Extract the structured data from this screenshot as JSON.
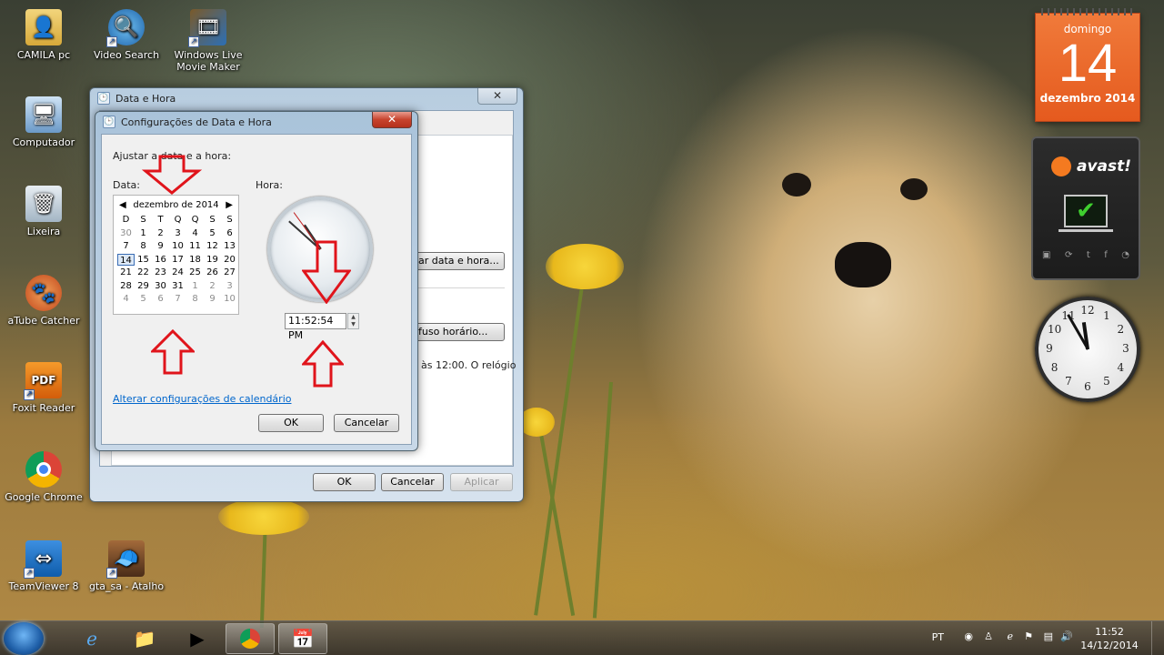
{
  "desktop": {
    "icons": [
      {
        "label": "CAMILA pc"
      },
      {
        "label": "Video Search"
      },
      {
        "label": "Windows Live Movie Maker"
      },
      {
        "label": "Computador"
      },
      {
        "label": "Lixeira"
      },
      {
        "label": "aTube Catcher"
      },
      {
        "label": "Foxit Reader"
      },
      {
        "label": "Google Chrome"
      },
      {
        "label": "TeamViewer 8"
      },
      {
        "label": "gta_sa - Atalho"
      }
    ]
  },
  "back_window": {
    "title": "Data e Hora",
    "change_date_button": "ar data e hora...",
    "timezone_button": "fuso horário...",
    "text_fragment": "às 12:00. O relógio",
    "ok": "OK",
    "cancel": "Cancelar",
    "apply": "Aplicar"
  },
  "dialog": {
    "title": "Configurações de Data e Hora",
    "instruction": "Ajustar a data e a hora:",
    "date_label": "Data:",
    "time_label": "Hora:",
    "calendar": {
      "month_year": "dezembro de 2014",
      "weekdays": [
        "D",
        "S",
        "T",
        "Q",
        "Q",
        "S",
        "S"
      ],
      "weeks": [
        [
          "30",
          "1",
          "2",
          "3",
          "4",
          "5",
          "6"
        ],
        [
          "7",
          "8",
          "9",
          "10",
          "11",
          "12",
          "13"
        ],
        [
          "14",
          "15",
          "16",
          "17",
          "18",
          "19",
          "20"
        ],
        [
          "21",
          "22",
          "23",
          "24",
          "25",
          "26",
          "27"
        ],
        [
          "28",
          "29",
          "30",
          "31",
          "1",
          "2",
          "3"
        ],
        [
          "4",
          "5",
          "6",
          "7",
          "8",
          "9",
          "10"
        ]
      ],
      "selected_day": "14"
    },
    "time_value": "11:52:54 PM",
    "calendar_link": "Alterar configurações de calendário",
    "ok": "OK",
    "cancel": "Cancelar"
  },
  "gadgets": {
    "calendar": {
      "weekday": "domingo",
      "day": "14",
      "month_year": "dezembro 2014"
    },
    "avast": {
      "brand": "avast!"
    },
    "clock": {
      "numerals": [
        "12",
        "1",
        "2",
        "3",
        "4",
        "5",
        "6",
        "7",
        "8",
        "9",
        "10",
        "11"
      ]
    }
  },
  "taskbar": {
    "language": "PT",
    "time": "11:52",
    "date": "14/12/2014"
  },
  "colors": {
    "arrow": "#e0141b",
    "calendar_gadget": "#e55a1e",
    "link": "#0066cc"
  }
}
